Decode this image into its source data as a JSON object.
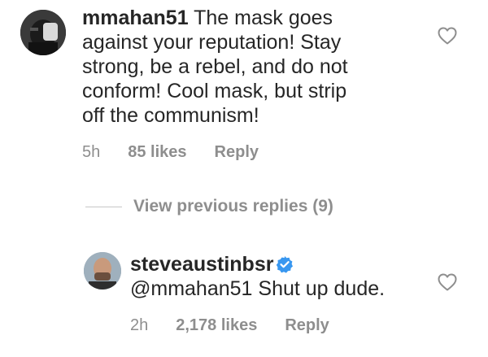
{
  "comment": {
    "username": "mmahan51",
    "text_line1": "The mask goes",
    "text_line2": "against your reputation!  Stay",
    "text_line3": "strong, be a rebel, and do not",
    "text_line4": "conform!  Cool mask, but strip",
    "text_line5": "off the communism!",
    "time": "5h",
    "likes": "85 likes",
    "reply_label": "Reply",
    "like_icon": "heart-outline-icon"
  },
  "view_previous": {
    "label": "View previous replies (9)"
  },
  "reply": {
    "username": "steveaustinbsr",
    "verified_icon": "verified-badge-icon",
    "mention": "@mmahan51",
    "text": " Shut up dude.",
    "time": "2h",
    "likes": "2,178 likes",
    "reply_label": "Reply",
    "like_icon": "heart-outline-icon"
  },
  "colors": {
    "text": "#262626",
    "secondary": "#8e8e8e",
    "verified": "#3897f0"
  }
}
